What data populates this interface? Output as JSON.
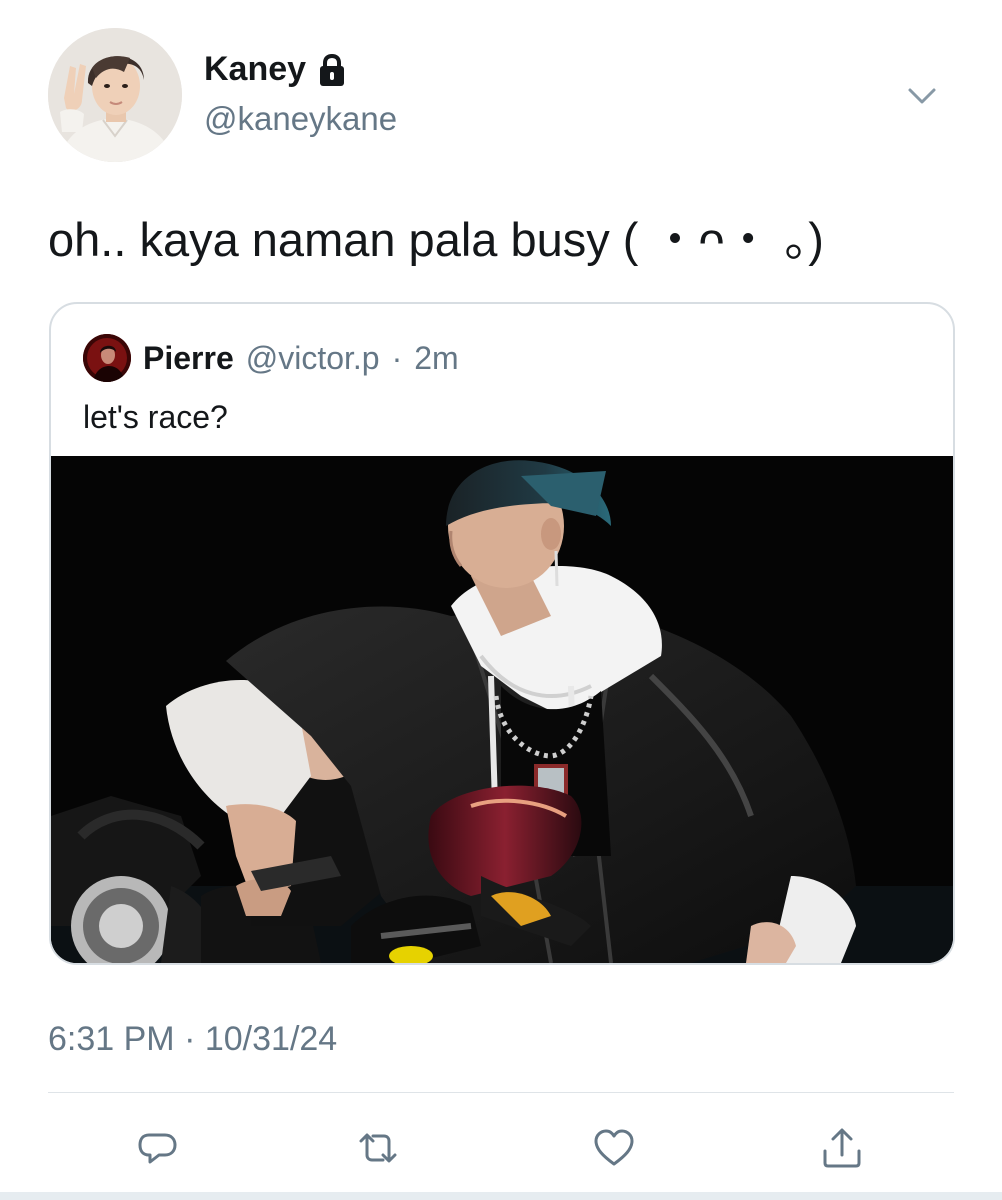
{
  "author": {
    "display_name": "Kaney",
    "handle": "@kaneykane",
    "avatar_icon": "profile-photo",
    "protected_icon": "lock-icon"
  },
  "tweet": {
    "text": "oh.. kaya naman pala busy ( ・ᴖ・ ｡)"
  },
  "quoted": {
    "display_name": "Pierre",
    "handle": "@victor.p",
    "separator": "·",
    "time": "2m",
    "text": "let's race?",
    "media_icon": "photo-person-on-motorbike"
  },
  "meta": {
    "time": "6:31 PM",
    "separator": "·",
    "date": "10/31/24"
  },
  "actions": {
    "reply_icon": "reply-icon",
    "retweet_icon": "retweet-icon",
    "like_icon": "heart-icon",
    "share_icon": "share-icon"
  },
  "colors": {
    "text": "#14171a",
    "secondary": "#657786",
    "border": "#d7dde2"
  }
}
